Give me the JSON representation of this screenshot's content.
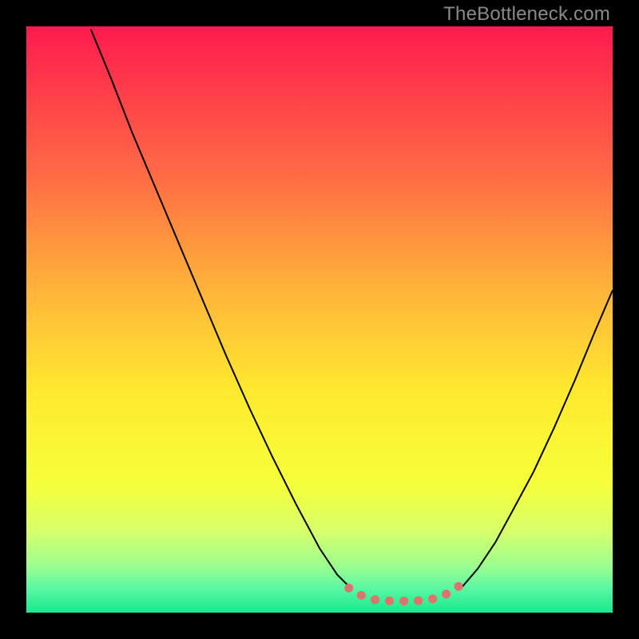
{
  "watermark": "TheBottleneck.com",
  "chart_data": {
    "type": "line",
    "title": "",
    "xlabel": "",
    "ylabel": "",
    "xlim": [
      0,
      100
    ],
    "ylim": [
      0,
      100
    ],
    "gradient_stops": [
      {
        "pct": 0,
        "color": "#ff1a4f"
      },
      {
        "pct": 10,
        "color": "#ff3a4a"
      },
      {
        "pct": 25,
        "color": "#ff6a45"
      },
      {
        "pct": 45,
        "color": "#ffb43a"
      },
      {
        "pct": 62,
        "color": "#ffe92f"
      },
      {
        "pct": 78,
        "color": "#f6ff3a"
      },
      {
        "pct": 86,
        "color": "#d8ff6a"
      },
      {
        "pct": 92,
        "color": "#9cff8f"
      },
      {
        "pct": 96,
        "color": "#58f7a4"
      },
      {
        "pct": 100,
        "color": "#17e88a"
      }
    ],
    "series": [
      {
        "name": "left-curve",
        "color": "#000000",
        "width": 2,
        "x": [
          11.0,
          14.5,
          18.0,
          22.0,
          26.0,
          30.0,
          34.0,
          38.0,
          42.0,
          46.0,
          50.0,
          53.0,
          55.5
        ],
        "y": [
          99.5,
          91.0,
          82.0,
          72.5,
          63.0,
          53.5,
          44.0,
          35.0,
          26.5,
          18.5,
          11.0,
          6.5,
          4.0
        ]
      },
      {
        "name": "right-curve",
        "color": "#000000",
        "width": 2,
        "x": [
          74.0,
          77.0,
          80.0,
          83.0,
          86.5,
          90.0,
          93.5,
          97.0,
          100.0
        ],
        "y": [
          4.0,
          7.5,
          12.0,
          17.5,
          24.0,
          31.5,
          39.5,
          48.0,
          55.0
        ]
      },
      {
        "name": "valley-highlight",
        "color": "#e0726b",
        "width": 11,
        "linecap": "round",
        "dash": "0.1 18",
        "x": [
          55.0,
          57.0,
          58.5,
          60.0,
          62.0,
          64.0,
          66.0,
          68.0,
          70.0,
          71.5,
          73.0,
          74.5
        ],
        "y": [
          4.2,
          3.0,
          2.4,
          2.1,
          2.0,
          2.0,
          2.0,
          2.1,
          2.5,
          3.1,
          4.0,
          5.0
        ]
      }
    ]
  }
}
